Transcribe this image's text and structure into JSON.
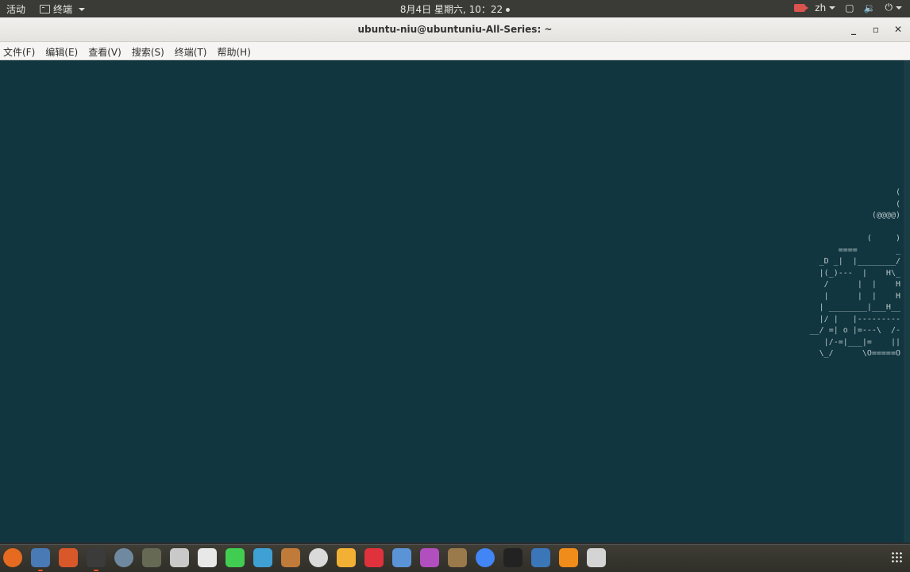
{
  "topbar": {
    "activities": "活动",
    "app_menu": "终端",
    "clock": "8月4日 星期六, 10：22",
    "input_method": "zh"
  },
  "window": {
    "title": "ubuntu-niu@ubuntuniu-All-Series: ~",
    "controls": {
      "minimize": "_",
      "maximize": "▫",
      "close": "✕"
    }
  },
  "menubar": {
    "items": [
      "文件(F)",
      "编辑(E)",
      "查看(V)",
      "搜索(S)",
      "终端(T)",
      "帮助(H)"
    ]
  },
  "terminal": {
    "background": "#113640",
    "ascii_art": "(\n(\n(@@@@)\n\n(     )\n====        _\n_D _|  |________/\n|(_)---  |    H\\_\n/      |  |    H\n|      |  |    H\n| ________|___H__\n|/ |   |---------\n__/ =| o |=---\\  /-\n|/-=|___|=    ||\n\\_/      \\O=====O"
  },
  "dock": {
    "icons": [
      {
        "name": "firefox-icon",
        "color": "#e66a1f"
      },
      {
        "name": "files-icon",
        "color": "#4a7ab5"
      },
      {
        "name": "software-center-icon",
        "color": "#d8582a"
      },
      {
        "name": "terminal-icon",
        "color": "#3b3b3b"
      },
      {
        "name": "compass-icon",
        "color": "#6f8aa0"
      },
      {
        "name": "turtle-icon",
        "color": "#666a55"
      },
      {
        "name": "cubes-icon",
        "color": "#c9c9c9"
      },
      {
        "name": "text-editor-icon",
        "color": "#e8e8e8"
      },
      {
        "name": "qt-creator-icon",
        "color": "#41cd52"
      },
      {
        "name": "xmind-icon",
        "color": "#3fa0d4"
      },
      {
        "name": "cone-icon",
        "color": "#c07a3a"
      },
      {
        "name": "sphere-icon",
        "color": "#dadada"
      },
      {
        "name": "headphones-icon",
        "color": "#f2b134"
      },
      {
        "name": "music-icon",
        "color": "#e0323c"
      },
      {
        "name": "satellite-icon",
        "color": "#5a94d6"
      },
      {
        "name": "image-viewer-icon",
        "color": "#b14fbf"
      },
      {
        "name": "package-icon",
        "color": "#9a7a4a"
      },
      {
        "name": "chrome-icon",
        "color": "#4285f4"
      },
      {
        "name": "ninja-icon",
        "color": "#222222"
      },
      {
        "name": "virtualbox-icon",
        "color": "#3a76b8"
      },
      {
        "name": "vlc-icon",
        "color": "#f08c1a"
      },
      {
        "name": "screenshot-icon",
        "color": "#d4d4d4"
      }
    ]
  }
}
